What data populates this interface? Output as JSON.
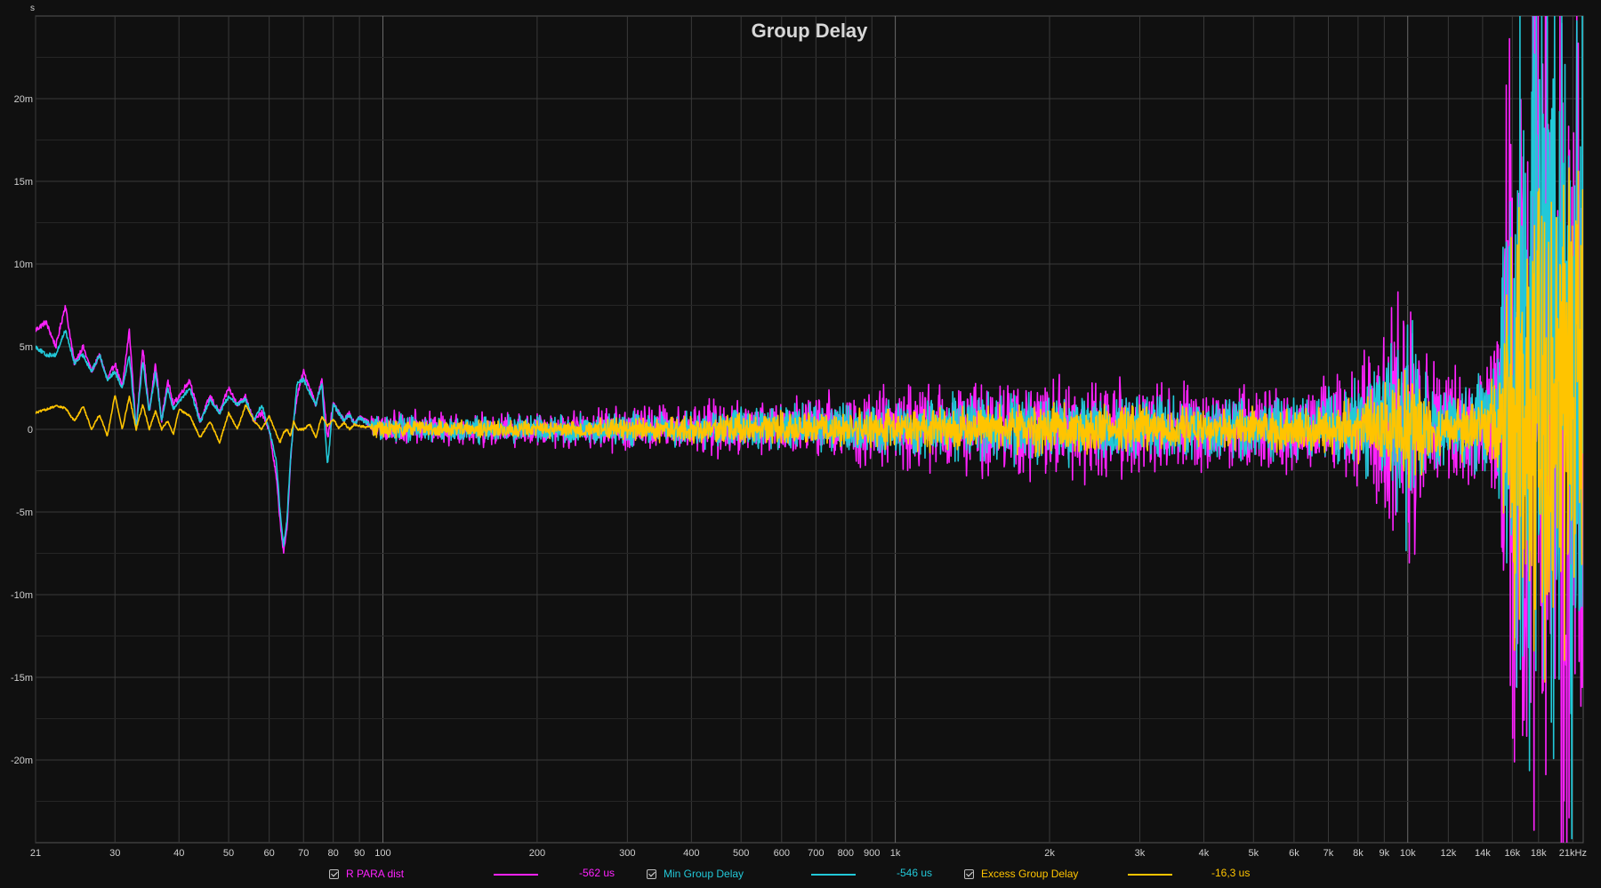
{
  "chart_data": {
    "type": "line",
    "title": "Group Delay",
    "y_unit": "s",
    "x_scale": "log",
    "xlim": [
      21,
      22000
    ],
    "ylim": [
      -0.025,
      0.025
    ],
    "x_ticks": [
      {
        "v": 21,
        "t": "21"
      },
      {
        "v": 30,
        "t": "30"
      },
      {
        "v": 40,
        "t": "40"
      },
      {
        "v": 50,
        "t": "50"
      },
      {
        "v": 60,
        "t": "60"
      },
      {
        "v": 70,
        "t": "70"
      },
      {
        "v": 80,
        "t": "80"
      },
      {
        "v": 90,
        "t": "90"
      },
      {
        "v": 100,
        "t": "100"
      },
      {
        "v": 200,
        "t": "200"
      },
      {
        "v": 300,
        "t": "300"
      },
      {
        "v": 400,
        "t": "400"
      },
      {
        "v": 500,
        "t": "500"
      },
      {
        "v": 600,
        "t": "600"
      },
      {
        "v": 700,
        "t": "700"
      },
      {
        "v": 800,
        "t": "800"
      },
      {
        "v": 900,
        "t": "900"
      },
      {
        "v": 1000,
        "t": "1k"
      },
      {
        "v": 2000,
        "t": "2k"
      },
      {
        "v": 3000,
        "t": "3k"
      },
      {
        "v": 4000,
        "t": "4k"
      },
      {
        "v": 5000,
        "t": "5k"
      },
      {
        "v": 6000,
        "t": "6k"
      },
      {
        "v": 7000,
        "t": "7k"
      },
      {
        "v": 8000,
        "t": "8k"
      },
      {
        "v": 9000,
        "t": "9k"
      },
      {
        "v": 10000,
        "t": "10k"
      },
      {
        "v": 12000,
        "t": "12k"
      },
      {
        "v": 14000,
        "t": "14k"
      },
      {
        "v": 16000,
        "t": "16k"
      },
      {
        "v": 18000,
        "t": "18k"
      },
      {
        "v": 21000,
        "t": "21kHz"
      }
    ],
    "y_ticks": [
      {
        "v": 0.02,
        "t": "20m"
      },
      {
        "v": 0.015,
        "t": "15m"
      },
      {
        "v": 0.01,
        "t": "10m"
      },
      {
        "v": 0.005,
        "t": "5m"
      },
      {
        "v": 0,
        "t": "0"
      },
      {
        "v": -0.005,
        "t": "-5m"
      },
      {
        "v": -0.01,
        "t": "-10m"
      },
      {
        "v": -0.015,
        "t": "-15m"
      },
      {
        "v": -0.02,
        "t": "-20m"
      }
    ],
    "series": [
      {
        "name": "R PARA dist",
        "color": "#ff22ff",
        "legend_value": "-562 us",
        "x": [
          21,
          22,
          23,
          24,
          25,
          26,
          27,
          28,
          29,
          30,
          31,
          32,
          33,
          34,
          35,
          36,
          37,
          38,
          39,
          40,
          42,
          44,
          46,
          48,
          50,
          52,
          54,
          56,
          58,
          60,
          62,
          63,
          64,
          65,
          66,
          67,
          68,
          70,
          72,
          74,
          76,
          78,
          80,
          82,
          84,
          86,
          88,
          90,
          95,
          100,
          110,
          120,
          130,
          140,
          150,
          170,
          200,
          250,
          300,
          400,
          500,
          700,
          1000,
          1500,
          2000,
          3000,
          4000,
          5000,
          6000,
          7000,
          8000,
          9000,
          9500,
          10000,
          10500,
          11000,
          12000,
          13000,
          14000,
          15000,
          16000,
          17000,
          18000,
          19000,
          20000,
          21000,
          22000
        ],
        "y": [
          0.006,
          0.0065,
          0.005,
          0.0075,
          0.004,
          0.005,
          0.0035,
          0.0045,
          0.003,
          0.004,
          0.0025,
          0.006,
          0.0,
          0.005,
          0.001,
          0.004,
          0.0005,
          0.003,
          0.0015,
          0.002,
          0.003,
          0.0005,
          0.002,
          0.001,
          0.0025,
          0.0015,
          0.002,
          0.0005,
          0.001,
          0.0,
          -0.003,
          -0.0055,
          -0.0075,
          -0.006,
          -0.002,
          0.0005,
          0.002,
          0.0035,
          0.0025,
          0.0015,
          0.003,
          -0.0005,
          0.0015,
          0.001,
          0.0005,
          0.001,
          0.0003,
          0.0008,
          0.0002,
          0.0004,
          0.0002,
          0.0003,
          0.0001,
          0.0002,
          0.0001,
          0.0001,
          0.0002,
          0.0001,
          0.0002,
          0.0003,
          0.0004,
          0.0005,
          0.0006,
          0.0005,
          0.0004,
          0.0003,
          0.0004,
          0.0005,
          0.0006,
          0.0008,
          0.001,
          0.0015,
          0.003,
          0.0035,
          0.002,
          0.001,
          0.001,
          0.0008,
          0.0015,
          0.003,
          0.01,
          0.02,
          0.015,
          0.022,
          0.01,
          0.015,
          0.012
        ],
        "spread": [
          0.0008,
          0.0008,
          0.0008,
          0.0008,
          0.0008,
          0.0008,
          0.0008,
          0.0008,
          0.0008,
          0.0008,
          0.0008,
          0.0008,
          0.0008,
          0.0008,
          0.0008,
          0.0008,
          0.0008,
          0.0008,
          0.0008,
          0.0008,
          0.0008,
          0.0008,
          0.0008,
          0.0008,
          0.0008,
          0.0008,
          0.0008,
          0.0008,
          0.0008,
          0.0008,
          0.0008,
          0.0008,
          0.0008,
          0.0008,
          0.0008,
          0.0008,
          0.0008,
          0.0008,
          0.0008,
          0.0008,
          0.0008,
          0.0008,
          0.0008,
          0.0008,
          0.0008,
          0.0008,
          0.0008,
          0.0008,
          0.0009,
          0.001,
          0.001,
          0.001,
          0.001,
          0.001,
          0.001,
          0.001,
          0.001,
          0.0012,
          0.0014,
          0.0015,
          0.0017,
          0.002,
          0.0025,
          0.0028,
          0.003,
          0.0028,
          0.0025,
          0.0025,
          0.0027,
          0.003,
          0.0035,
          0.005,
          0.007,
          0.009,
          0.006,
          0.004,
          0.003,
          0.0035,
          0.004,
          0.005,
          0.025,
          0.03,
          0.03,
          0.03,
          0.03,
          0.03,
          0.03
        ]
      },
      {
        "name": "Min Group Delay",
        "color": "#22c8d8",
        "legend_value": "-546 us",
        "x": [
          21,
          22,
          23,
          24,
          25,
          26,
          27,
          28,
          29,
          30,
          31,
          32,
          33,
          34,
          35,
          36,
          37,
          38,
          39,
          40,
          42,
          44,
          46,
          48,
          50,
          52,
          54,
          56,
          58,
          60,
          62,
          63,
          64,
          65,
          66,
          67,
          68,
          70,
          72,
          74,
          76,
          78,
          80,
          82,
          84,
          86,
          88,
          90,
          95,
          100,
          110,
          120,
          130,
          140,
          150,
          170,
          200,
          250,
          300,
          400,
          500,
          700,
          1000,
          1500,
          2000,
          3000,
          4000,
          5000,
          6000,
          7000,
          8000,
          9000,
          9500,
          10000,
          10500,
          11000,
          12000,
          13000,
          14000,
          15000,
          16000,
          17000,
          18000,
          19000,
          20000,
          21000,
          22000
        ],
        "y": [
          0.005,
          0.0045,
          0.0045,
          0.006,
          0.004,
          0.0045,
          0.0035,
          0.0045,
          0.003,
          0.0035,
          0.0025,
          0.0045,
          0.0,
          0.0042,
          0.001,
          0.0035,
          0.0005,
          0.0025,
          0.0012,
          0.0017,
          0.0025,
          0.0004,
          0.0018,
          0.001,
          0.002,
          0.0015,
          0.0018,
          0.0005,
          0.0015,
          0.0,
          -0.002,
          -0.005,
          -0.007,
          -0.0055,
          -0.0018,
          0.0005,
          0.0028,
          0.003,
          0.0022,
          0.0015,
          0.0028,
          -0.0022,
          0.0015,
          0.001,
          0.0005,
          0.0009,
          0.0003,
          0.0007,
          0.0002,
          0.0003,
          0.0002,
          0.0002,
          0.0001,
          0.0002,
          0.0001,
          0.0001,
          0.0001,
          0.0001,
          0.0002,
          0.0002,
          0.0003,
          0.0004,
          0.0004,
          0.0004,
          0.0003,
          0.0002,
          0.0003,
          0.0004,
          0.0005,
          0.0006,
          0.0008,
          0.001,
          0.002,
          0.0025,
          0.0015,
          0.0008,
          0.0008,
          0.0006,
          0.001,
          0.002,
          0.008,
          0.018,
          0.012,
          0.02,
          0.008,
          0.012,
          0.01
        ],
        "spread": [
          0.0006,
          0.0006,
          0.0006,
          0.0006,
          0.0006,
          0.0006,
          0.0006,
          0.0006,
          0.0006,
          0.0006,
          0.0006,
          0.0006,
          0.0006,
          0.0006,
          0.0006,
          0.0006,
          0.0006,
          0.0006,
          0.0006,
          0.0006,
          0.0006,
          0.0006,
          0.0006,
          0.0006,
          0.0006,
          0.0006,
          0.0006,
          0.0006,
          0.0006,
          0.0006,
          0.0006,
          0.0006,
          0.0006,
          0.0006,
          0.0006,
          0.0006,
          0.0006,
          0.0006,
          0.0006,
          0.0006,
          0.0006,
          0.0006,
          0.0006,
          0.0006,
          0.0006,
          0.0006,
          0.0006,
          0.0006,
          0.0007,
          0.0008,
          0.0008,
          0.0008,
          0.0008,
          0.0008,
          0.0008,
          0.0008,
          0.0008,
          0.0009,
          0.001,
          0.0011,
          0.0012,
          0.0014,
          0.0018,
          0.002,
          0.0022,
          0.002,
          0.0018,
          0.0018,
          0.002,
          0.0022,
          0.0026,
          0.004,
          0.0055,
          0.007,
          0.005,
          0.003,
          0.0022,
          0.0025,
          0.003,
          0.004,
          0.02,
          0.025,
          0.025,
          0.025,
          0.025,
          0.025,
          0.025
        ]
      },
      {
        "name": "Excess Group Delay",
        "color": "#ffc400",
        "legend_value": "-16,3 us",
        "x": [
          21,
          22,
          23,
          24,
          25,
          26,
          27,
          28,
          29,
          30,
          31,
          32,
          33,
          34,
          35,
          36,
          37,
          38,
          39,
          40,
          42,
          44,
          46,
          48,
          50,
          52,
          54,
          56,
          58,
          60,
          62,
          63,
          64,
          65,
          66,
          67,
          68,
          70,
          72,
          74,
          76,
          78,
          80,
          82,
          84,
          86,
          88,
          90,
          95,
          100,
          110,
          120,
          130,
          140,
          150,
          170,
          200,
          250,
          300,
          400,
          500,
          700,
          1000,
          1500,
          2000,
          3000,
          4000,
          5000,
          6000,
          7000,
          8000,
          9000,
          9500,
          10000,
          10500,
          11000,
          12000,
          13000,
          14000,
          15000,
          16000,
          17000,
          18000,
          19000,
          20000,
          21000,
          22000
        ],
        "y": [
          0.001,
          0.0012,
          0.0014,
          0.0013,
          0.0005,
          0.0014,
          0.0,
          0.0009,
          -0.0004,
          0.0021,
          0.0,
          0.002,
          0.0,
          0.0015,
          0.0,
          0.0011,
          0.0,
          0.0005,
          -0.0003,
          0.0012,
          0.0008,
          -0.0005,
          0.0005,
          -0.0008,
          0.001,
          0.0,
          0.0015,
          0.0005,
          0.0,
          0.0008,
          -0.0003,
          -0.0008,
          -0.0002,
          0.0,
          -0.0004,
          0.0005,
          0.0,
          0.0,
          0.0003,
          -0.0005,
          0.0008,
          0.0002,
          0.0006,
          0.0001,
          0.0004,
          0.0,
          0.0003,
          0.0002,
          0.0001,
          0.0,
          0.0001,
          0.0,
          0.0001,
          0.0,
          0.0001,
          0.0,
          0.0001,
          0.0,
          0.0001,
          0.0,
          0.0001,
          0.0001,
          0.0001,
          0.0001,
          0.0001,
          0.0,
          0.0001,
          0.0001,
          0.0001,
          0.0001,
          0.0002,
          0.0003,
          0.0008,
          0.001,
          0.0005,
          0.0003,
          0.0003,
          0.0002,
          0.0003,
          0.0005,
          0.001,
          0.003,
          0.002,
          0.004,
          0.002,
          0.003,
          0.002
        ],
        "spread": [
          0.0003,
          0.0003,
          0.0003,
          0.0003,
          0.0003,
          0.0003,
          0.0003,
          0.0003,
          0.0003,
          0.0003,
          0.0003,
          0.0003,
          0.0003,
          0.0003,
          0.0003,
          0.0003,
          0.0003,
          0.0003,
          0.0003,
          0.0003,
          0.0003,
          0.0003,
          0.0003,
          0.0003,
          0.0003,
          0.0003,
          0.0003,
          0.0003,
          0.0003,
          0.0003,
          0.0003,
          0.0003,
          0.0003,
          0.0003,
          0.0003,
          0.0003,
          0.0003,
          0.0003,
          0.0003,
          0.0003,
          0.0003,
          0.0003,
          0.0003,
          0.0003,
          0.0003,
          0.0003,
          0.0003,
          0.0003,
          0.0004,
          0.0005,
          0.0005,
          0.0005,
          0.0005,
          0.0005,
          0.0005,
          0.0005,
          0.0005,
          0.0006,
          0.0007,
          0.0008,
          0.0009,
          0.001,
          0.0012,
          0.0014,
          0.0015,
          0.0014,
          0.0012,
          0.0012,
          0.0014,
          0.0015,
          0.0018,
          0.0025,
          0.0035,
          0.0045,
          0.003,
          0.002,
          0.0015,
          0.0018,
          0.002,
          0.003,
          0.012,
          0.015,
          0.015,
          0.015,
          0.015,
          0.015,
          0.015
        ]
      }
    ],
    "grid": true,
    "legend_position": "bottom"
  },
  "colors": {
    "background": "#101010",
    "grid": "#3a3a3a",
    "grid_major": "#6a6a6a",
    "text": "#cfcfcf"
  }
}
